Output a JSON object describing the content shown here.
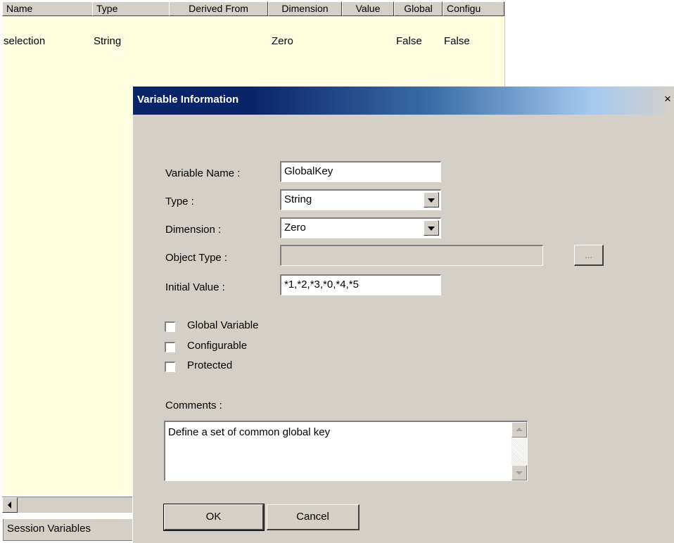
{
  "table": {
    "columns": [
      "Name",
      "Type",
      "Derived From",
      "Dimension",
      "Value",
      "Global",
      "Configu"
    ],
    "rows": [
      {
        "name": "selection",
        "type": "String",
        "derived_from": "",
        "dimension": "Zero",
        "value": "",
        "global": "False",
        "configurable": "False"
      }
    ]
  },
  "tab": {
    "label": "Session Variables"
  },
  "dialog": {
    "title": "Variable Information",
    "close_glyph": "×",
    "fields": {
      "variable_name": {
        "label": "Variable Name :",
        "value": "GlobalKey"
      },
      "type": {
        "label": "Type :",
        "value": "String"
      },
      "dimension": {
        "label": "Dimension :",
        "value": "Zero"
      },
      "object_type": {
        "label": "Object Type :",
        "value": "",
        "button_label": "..."
      },
      "initial_value": {
        "label": "Initial Value :",
        "value": "*1,*2,*3,*0,*4,*5"
      }
    },
    "checkboxes": [
      {
        "label": "Global Variable",
        "checked": false
      },
      {
        "label": "Configurable",
        "checked": false
      },
      {
        "label": "Protected",
        "checked": false
      }
    ],
    "comments": {
      "label": "Comments :",
      "value": "Define a set of common global key"
    },
    "buttons": {
      "ok": "OK",
      "cancel": "Cancel"
    }
  }
}
